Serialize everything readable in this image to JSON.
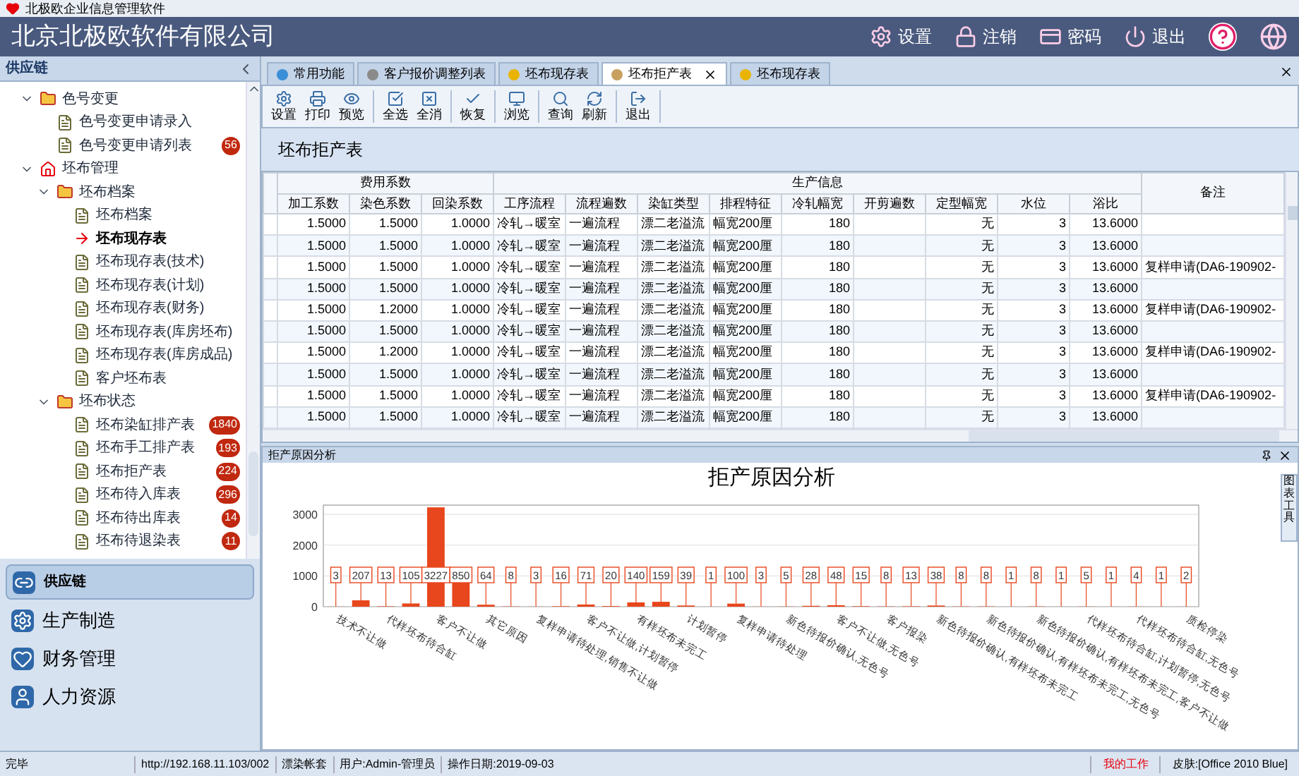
{
  "window": {
    "title": "北极欧企业信息管理软件"
  },
  "banner": {
    "company": "北京北极欧软件有限公司",
    "actions": [
      {
        "kind": "settings",
        "label": "设置"
      },
      {
        "kind": "lock",
        "label": "注销"
      },
      {
        "kind": "password",
        "label": "密码"
      },
      {
        "kind": "power",
        "label": "退出"
      }
    ]
  },
  "sidebar": {
    "title": "供应链",
    "tree": [
      {
        "label": "色号变更",
        "kind": "folder",
        "expanded": true,
        "selected": false,
        "children": [
          {
            "label": "色号变更申请录入",
            "kind": "page",
            "selected": false
          },
          {
            "label": "色号变更申请列表",
            "kind": "page",
            "selected": false,
            "badge": "56"
          }
        ]
      },
      {
        "label": "坯布管理",
        "kind": "module",
        "expanded": true,
        "selected": false,
        "children": [
          {
            "label": "坯布档案",
            "kind": "folder",
            "expanded": true,
            "selected": false,
            "children": [
              {
                "label": "坯布档案",
                "kind": "page",
                "selected": false
              },
              {
                "label": "坯布现存表",
                "kind": "page",
                "selected": true
              },
              {
                "label": "坯布现存表(技术)",
                "kind": "page",
                "selected": false
              },
              {
                "label": "坯布现存表(计划)",
                "kind": "page",
                "selected": false
              },
              {
                "label": "坯布现存表(财务)",
                "kind": "page",
                "selected": false
              },
              {
                "label": "坯布现存表(库房坯布)",
                "kind": "page",
                "selected": false
              },
              {
                "label": "坯布现存表(库房成品)",
                "kind": "page",
                "selected": false
              },
              {
                "label": "客户坯布表",
                "kind": "page",
                "selected": false
              }
            ]
          },
          {
            "label": "坯布状态",
            "kind": "folder",
            "expanded": true,
            "selected": false,
            "children": [
              {
                "label": "坯布染缸排产表",
                "kind": "page",
                "selected": false,
                "badge": "1840"
              },
              {
                "label": "坯布手工排产表",
                "kind": "page",
                "selected": false,
                "badge": "193"
              },
              {
                "label": "坯布拒产表",
                "kind": "page",
                "selected": false,
                "badge": "224"
              },
              {
                "label": "坯布待入库表",
                "kind": "page",
                "selected": false,
                "badge": "296"
              },
              {
                "label": "坯布待出库表",
                "kind": "page",
                "selected": false,
                "badge": "14"
              },
              {
                "label": "坯布待退染表",
                "kind": "page",
                "selected": false,
                "badge": "11"
              }
            ]
          }
        ]
      }
    ],
    "modules": [
      {
        "label": "供应链",
        "kind": "link",
        "selected": true
      },
      {
        "label": "生产制造",
        "kind": "gear",
        "selected": false
      },
      {
        "label": "财务管理",
        "kind": "heart",
        "selected": false
      },
      {
        "label": "人力资源",
        "kind": "person",
        "selected": false
      }
    ]
  },
  "tabs": [
    {
      "label": "常用功能",
      "kind": "cube",
      "selected": false,
      "closable": false
    },
    {
      "label": "客户报价调整列表",
      "kind": "edit",
      "selected": false,
      "closable": false
    },
    {
      "label": "坯布现存表",
      "kind": "dot",
      "selected": false,
      "closable": false
    },
    {
      "label": "坯布拒产表",
      "kind": "doc",
      "selected": true,
      "closable": true
    },
    {
      "label": "坯布现存表",
      "kind": "dot",
      "selected": false,
      "closable": false
    }
  ],
  "toolbar": [
    [
      {
        "label": "设置",
        "kind": "settings"
      },
      {
        "label": "打印",
        "kind": "print"
      },
      {
        "label": "预览",
        "kind": "preview"
      }
    ],
    [
      {
        "label": "全选",
        "kind": "selectall"
      },
      {
        "label": "全消",
        "kind": "clear"
      }
    ],
    [
      {
        "label": "恢复",
        "kind": "restore"
      }
    ],
    [
      {
        "label": "浏览",
        "kind": "browse"
      }
    ],
    [
      {
        "label": "查询",
        "kind": "query"
      },
      {
        "label": "刷新",
        "kind": "refresh"
      }
    ],
    [
      {
        "label": "退出",
        "kind": "exit"
      }
    ]
  ],
  "page_title": "坯布拒产表",
  "table": {
    "column_groups": [
      {
        "label": "费用系数",
        "columns": [
          "加工系数",
          "染色系数",
          "回染系数"
        ]
      },
      {
        "label": "生产信息",
        "columns": [
          "工序流程",
          "流程遍数",
          "染缸类型",
          "排程特征",
          "冷轧幅宽",
          "开剪遍数",
          "定型幅宽",
          "水位",
          "浴比"
        ]
      }
    ],
    "last_column": "备注",
    "rows": [
      [
        "1.5000",
        "1.5000",
        "1.0000",
        "冷轧→暖室",
        "一遍流程",
        "漂二老溢流",
        "幅宽200厘",
        "180",
        null,
        "无",
        "3",
        "13.6000",
        null
      ],
      [
        "1.5000",
        "1.5000",
        "1.0000",
        "冷轧→暖室",
        "一遍流程",
        "漂二老溢流",
        "幅宽200厘",
        "180",
        null,
        "无",
        "3",
        "13.6000",
        null
      ],
      [
        "1.5000",
        "1.5000",
        "1.0000",
        "冷轧→暖室",
        "一遍流程",
        "漂二老溢流",
        "幅宽200厘",
        "180",
        null,
        "无",
        "3",
        "13.6000",
        "复样申请(DA6-190902-"
      ],
      [
        "1.5000",
        "1.5000",
        "1.0000",
        "冷轧→暖室",
        "一遍流程",
        "漂二老溢流",
        "幅宽200厘",
        "180",
        null,
        "无",
        "3",
        "13.6000",
        null
      ],
      [
        "1.5000",
        "1.2000",
        "1.0000",
        "冷轧→暖室",
        "一遍流程",
        "漂二老溢流",
        "幅宽200厘",
        "180",
        null,
        "无",
        "3",
        "13.6000",
        "复样申请(DA6-190902-"
      ],
      [
        "1.5000",
        "1.5000",
        "1.0000",
        "冷轧→暖室",
        "一遍流程",
        "漂二老溢流",
        "幅宽200厘",
        "180",
        null,
        "无",
        "3",
        "13.6000",
        null
      ],
      [
        "1.5000",
        "1.2000",
        "1.0000",
        "冷轧→暖室",
        "一遍流程",
        "漂二老溢流",
        "幅宽200厘",
        "180",
        null,
        "无",
        "3",
        "13.6000",
        "复样申请(DA6-190902-"
      ],
      [
        "1.5000",
        "1.5000",
        "1.0000",
        "冷轧→暖室",
        "一遍流程",
        "漂二老溢流",
        "幅宽200厘",
        "180",
        null,
        "无",
        "3",
        "13.6000",
        null
      ],
      [
        "1.5000",
        "1.5000",
        "1.0000",
        "冷轧→暖室",
        "一遍流程",
        "漂二老溢流",
        "幅宽200厘",
        "180",
        null,
        "无",
        "3",
        "13.6000",
        "复样申请(DA6-190902-"
      ],
      [
        "1.5000",
        "1.5000",
        "1.0000",
        "冷轧→暖室",
        "一遍流程",
        "漂二老溢流",
        "幅宽200厘",
        "180",
        null,
        "无",
        "3",
        "13.6000",
        null
      ]
    ]
  },
  "chart_panel": {
    "title": "拒产原因分析",
    "side_tab": "图表工具",
    "chart_data": {
      "type": "bar",
      "title": "拒产原因分析",
      "categories": [
        "技术不让做",
        null,
        "代样坯布待合缸",
        null,
        "客户不让做",
        null,
        "其它原因",
        null,
        "复样申请待处理,销售不让做",
        null,
        "客户不让做,计划暂停",
        null,
        "有样坯布未完工",
        null,
        "计划暂停",
        null,
        "复样申请待处理",
        null,
        "新色待报价确认,无色号",
        null,
        "客户不让做,无色号",
        null,
        "客户报染",
        null,
        "新色待报价确认,有样坯布未完工",
        null,
        "新色待报价确认,有样坯布未完工,无色号",
        null,
        "新色待报价确认,有样坯布未完工,客户不让做",
        null,
        "代样坯布待合缸,计划暂停,无色号",
        null,
        "代样坯布待合缸,无色号",
        null,
        "质检停染"
      ],
      "series": [
        {
          "color": "#e8461c",
          "values": [
            3,
            207,
            13,
            105,
            3227,
            850,
            64,
            8,
            3,
            16,
            71,
            20,
            140,
            159,
            39,
            1,
            100,
            3,
            5,
            28,
            48,
            15,
            8,
            13,
            38,
            8,
            8,
            1,
            8,
            1,
            5,
            1,
            4,
            1,
            2
          ]
        }
      ],
      "ylim": [
        0,
        3300
      ],
      "yticks": [
        0,
        1000,
        2000,
        3000
      ],
      "grid": true,
      "data_labels": true
    }
  },
  "status_bar": {
    "state": "完毕",
    "url": "http://192.168.11.103/002",
    "account": "漂染帐套",
    "user": "用户:Admin-管理员",
    "date": "操作日期:2019-09-03",
    "work": "我的工作",
    "skin": "皮肤:[Office 2010 Blue]"
  }
}
